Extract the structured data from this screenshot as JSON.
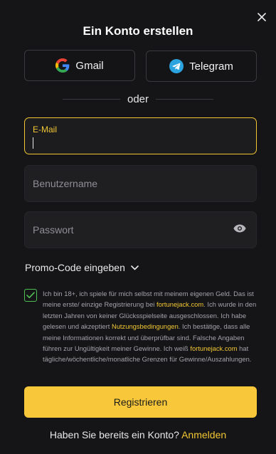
{
  "title": "Ein Konto erstellen",
  "social": {
    "gmail_label": "Gmail",
    "telegram_label": "Telegram"
  },
  "divider_text": "oder",
  "form": {
    "email_label": "E-Mail",
    "email_value": "",
    "username_placeholder": "Benutzername",
    "password_placeholder": "Passwort",
    "promo_label": "Promo-Code eingeben"
  },
  "terms": {
    "checked": true,
    "part1": "Ich bin 18+, ich spiele für mich selbst mit meinem eigenen Geld. Das ist meine erste/ einzige Registrierung bei ",
    "link1": "fortunejack.com",
    "part2": ". Ich wurde in den letzten Jahren von keiner Glücksspielseite ausgeschlossen. Ich habe gelesen und akzeptiert ",
    "link2": "Nutzungsbedingungen",
    "part3": ". Ich bestätige, dass alle meine Informationen korrekt und überprüfbar sind. Falsche Angaben führen zur Ungültigkeit meiner Gewinne. Ich weiß ",
    "link3": "fortunejack.com",
    "part4": " hat tägliche/wöchentliche/monatliche Grenzen für Gewinne/Auszahlungen."
  },
  "register_label": "Registrieren",
  "login": {
    "prompt": "Haben Sie bereits ein Konto? ",
    "link": "Anmelden"
  },
  "colors": {
    "accent": "#f8c83a",
    "background": "#151517",
    "checkbox": "#4fbf53"
  },
  "icons": {
    "close": "close-icon",
    "google": "google-icon",
    "telegram": "telegram-icon",
    "eye": "eye-icon",
    "chevron": "chevron-down-icon",
    "check": "checkmark-icon"
  }
}
